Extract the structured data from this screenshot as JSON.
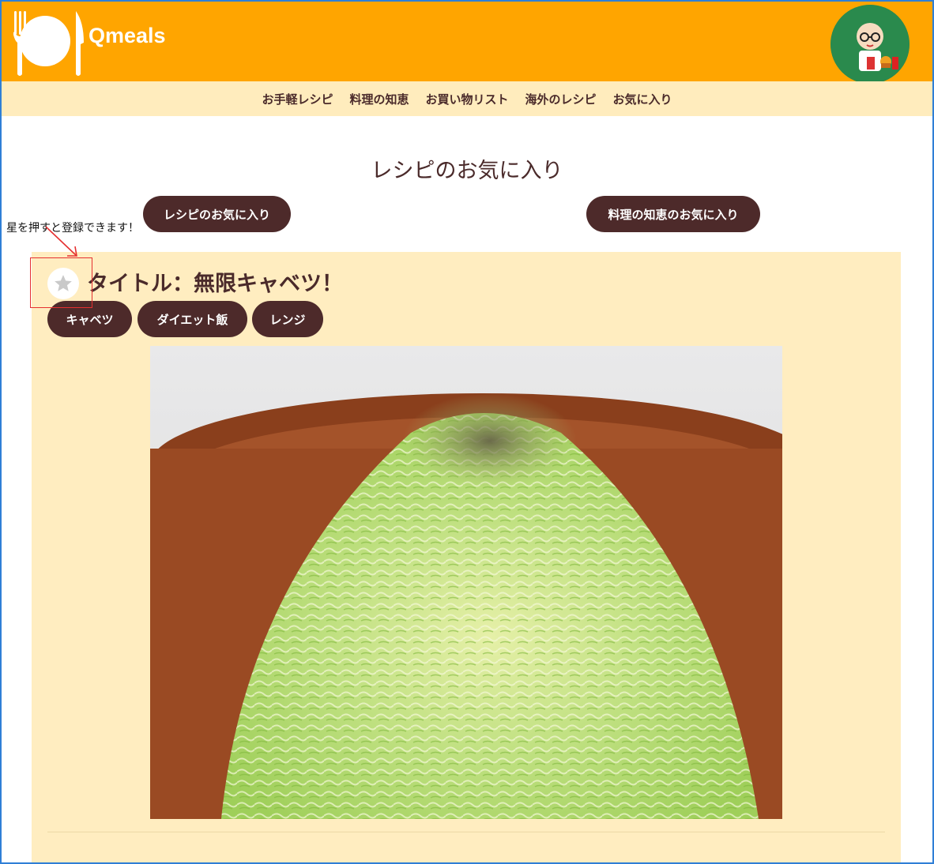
{
  "header": {
    "brand": "Qmeals",
    "logo_icon": "fork-plate-knife-icon",
    "avatar_icon": "user-avatar-icon",
    "background_color": "#ffa500"
  },
  "nav": {
    "items": [
      {
        "label": "お手軽レシピ"
      },
      {
        "label": "料理の知恵"
      },
      {
        "label": "お買い物リスト"
      },
      {
        "label": "海外のレシピ"
      },
      {
        "label": "お気に入り"
      }
    ],
    "background_color": "#ffecbd"
  },
  "main": {
    "page_title": "レシピのお気に入り",
    "tab_recipes": "レシピのお気に入り",
    "tab_tips": "料理の知恵のお気に入り",
    "hint": "星を押すと登録できます！"
  },
  "recipe": {
    "title": "タイトル：無限キャベツ！",
    "tags": [
      {
        "label": "キャベツ"
      },
      {
        "label": "ダイエット飯"
      },
      {
        "label": "レンジ"
      }
    ],
    "favorite_icon": "star-icon",
    "image_subject": "shredded-cabbage-salad-photo"
  },
  "colors": {
    "accent_dark": "#4d2a2a",
    "card_background": "#ffedc0",
    "annotation_red": "#e53030"
  }
}
